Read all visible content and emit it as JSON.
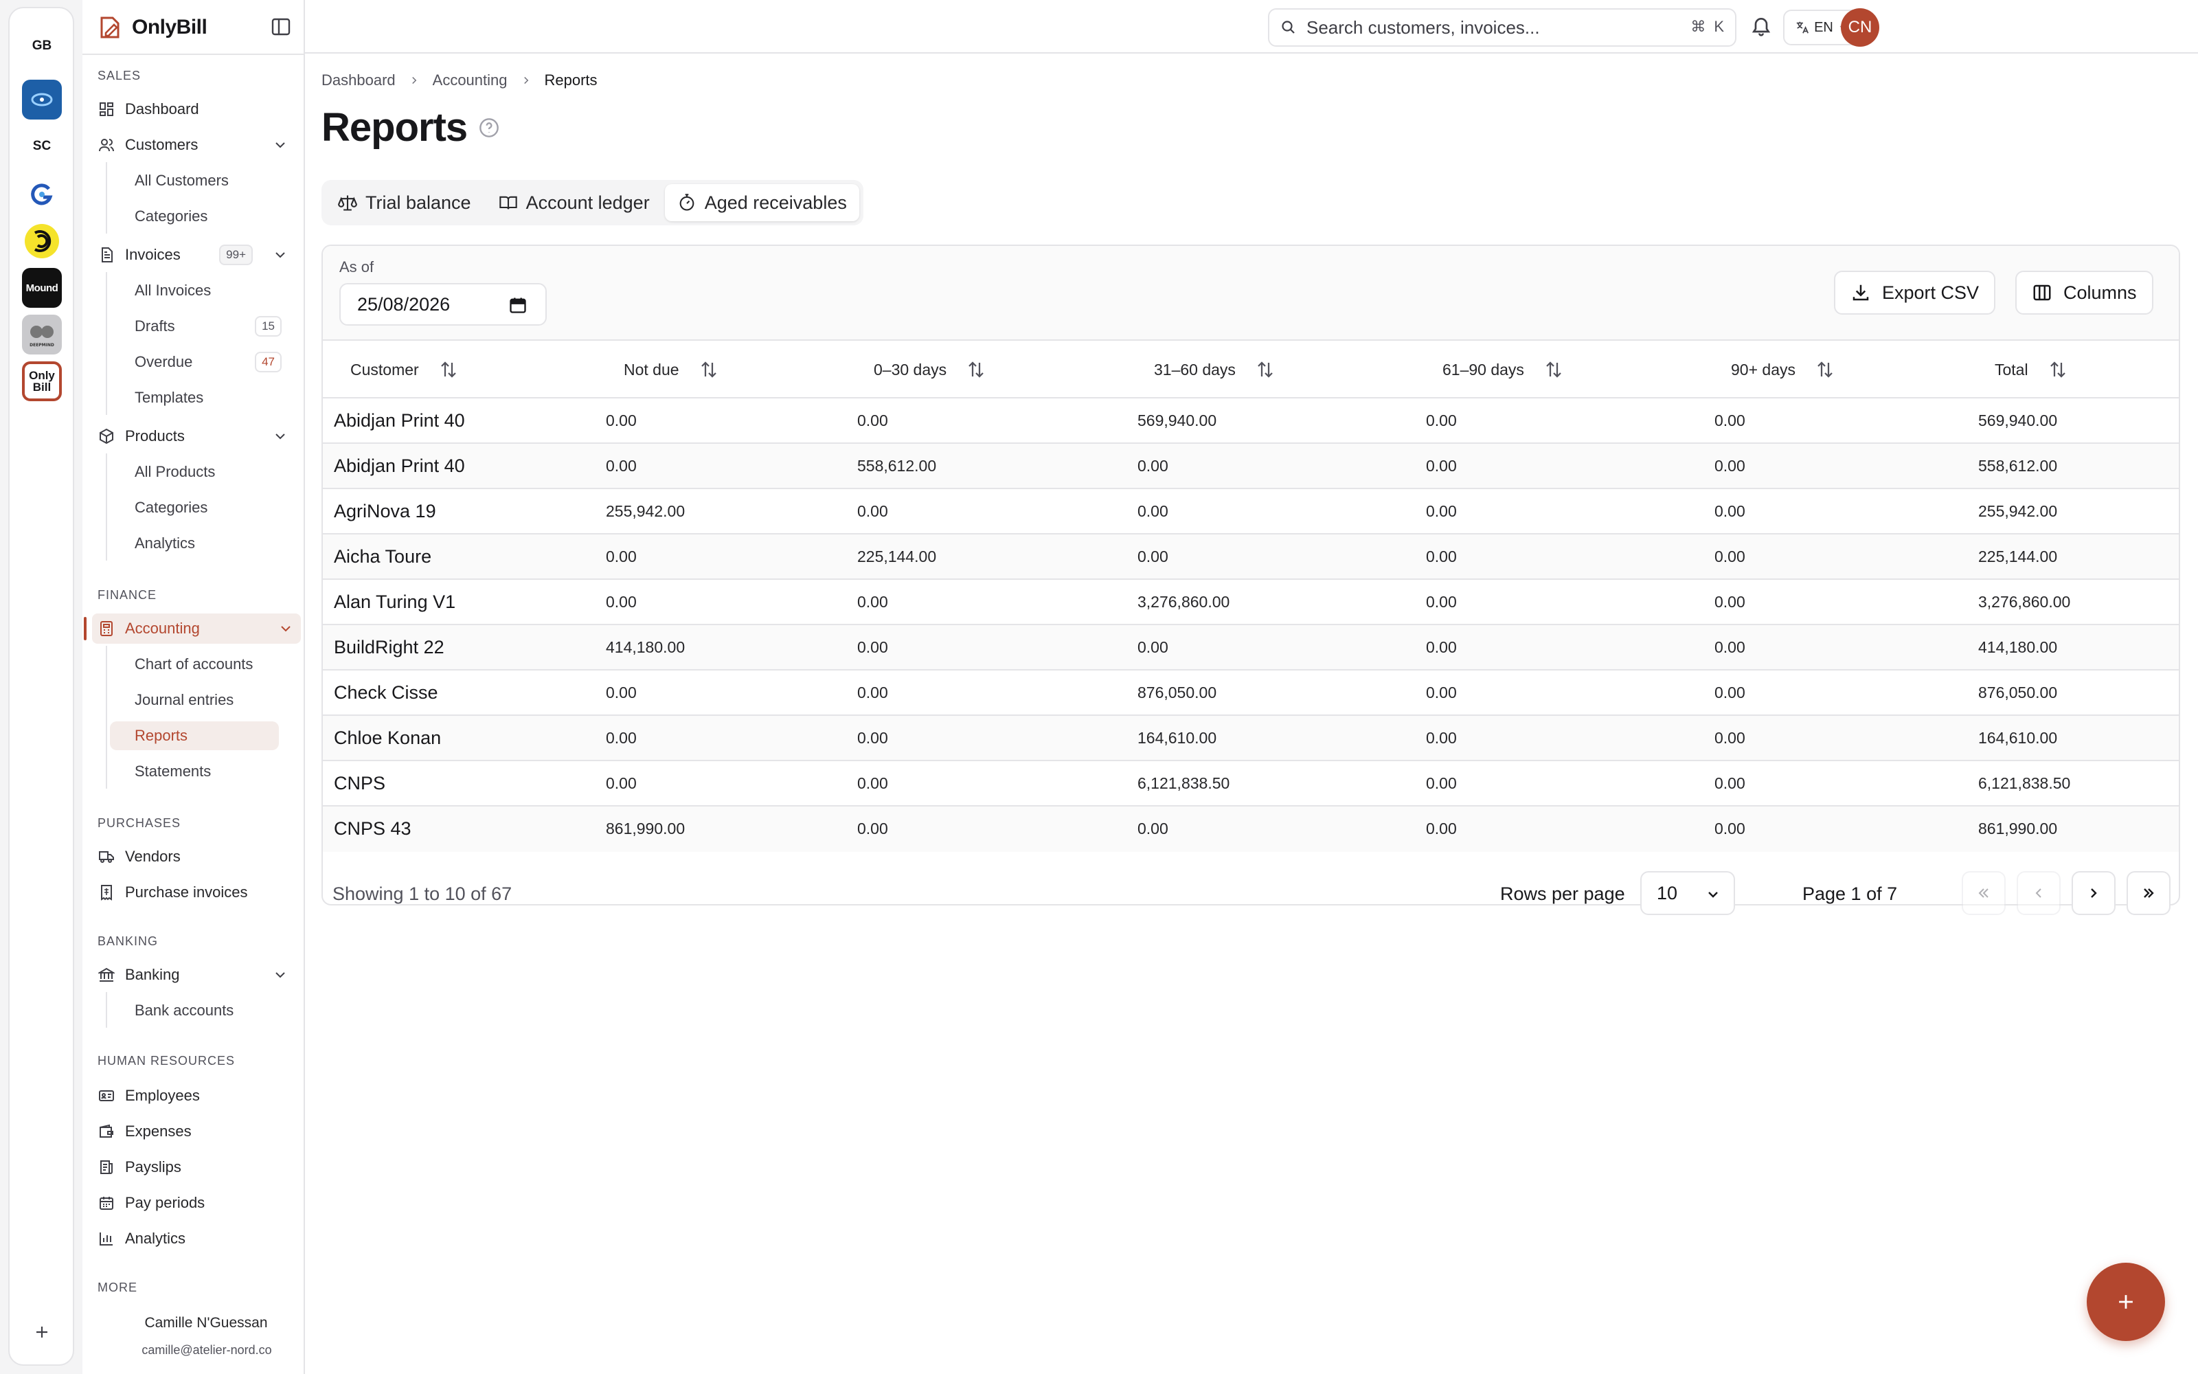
{
  "workspaces": {
    "items": [
      {
        "label": "GB",
        "kind": "text"
      },
      {
        "label": "",
        "kind": "blue"
      },
      {
        "label": "SC",
        "kind": "text"
      },
      {
        "label": "",
        "kind": "g"
      },
      {
        "label": "",
        "kind": "yellow"
      },
      {
        "label": "Mound",
        "kind": "mound"
      },
      {
        "label": "DEEPMIND",
        "kind": "deep"
      },
      {
        "label": "Only",
        "label2": "Bill",
        "kind": "ob"
      }
    ]
  },
  "brand": {
    "name": "OnlyBill"
  },
  "sidebar": {
    "sales_label": "SALES",
    "dashboard": "Dashboard",
    "customers": "Customers",
    "all_customers": "All Customers",
    "customer_categories": "Categories",
    "invoices": "Invoices",
    "invoices_badge": "99+",
    "all_invoices": "All Invoices",
    "drafts": "Drafts",
    "drafts_badge": "15",
    "overdue": "Overdue",
    "overdue_badge": "47",
    "templates": "Templates",
    "products": "Products",
    "all_products": "All Products",
    "product_categories": "Categories",
    "product_analytics": "Analytics",
    "finance_label": "FINANCE",
    "accounting": "Accounting",
    "chart_of_accounts": "Chart of accounts",
    "journal_entries": "Journal entries",
    "reports": "Reports",
    "statements": "Statements",
    "purchases_label": "PURCHASES",
    "vendors": "Vendors",
    "purchase_invoices": "Purchase invoices",
    "banking_label": "BANKING",
    "banking": "Banking",
    "bank_accounts": "Bank accounts",
    "hr_label": "HUMAN RESOURCES",
    "employees": "Employees",
    "expenses": "Expenses",
    "payslips": "Payslips",
    "pay_periods": "Pay periods",
    "hr_analytics": "Analytics",
    "more_label": "MORE"
  },
  "user": {
    "name": "Camille N'Guessan",
    "email": "camille@atelier-nord.co",
    "initials": "CN"
  },
  "topbar": {
    "search_placeholder": "Search customers, invoices...",
    "kbd_cmd": "⌘",
    "kbd_key": "K",
    "lang": "EN"
  },
  "breadcrumb": {
    "items": [
      "Dashboard",
      "Accounting",
      "Reports"
    ]
  },
  "page": {
    "title": "Reports"
  },
  "tabs": [
    {
      "label": "Trial balance",
      "active": false
    },
    {
      "label": "Account ledger",
      "active": false
    },
    {
      "label": "Aged receivables",
      "active": true
    }
  ],
  "filter": {
    "as_of_label": "As of",
    "as_of_value": "25/08/2026",
    "export_label": "Export CSV",
    "columns_label": "Columns"
  },
  "table": {
    "columns": [
      "Customer",
      "Not due",
      "0–30 days",
      "31–60 days",
      "61–90 days",
      "90+ days",
      "Total"
    ],
    "rows": [
      [
        "Abidjan Print 40",
        "0.00",
        "0.00",
        "569,940.00",
        "0.00",
        "0.00",
        "569,940.00"
      ],
      [
        "Abidjan Print 40",
        "0.00",
        "558,612.00",
        "0.00",
        "0.00",
        "0.00",
        "558,612.00"
      ],
      [
        "AgriNova 19",
        "255,942.00",
        "0.00",
        "0.00",
        "0.00",
        "0.00",
        "255,942.00"
      ],
      [
        "Aicha Toure",
        "0.00",
        "225,144.00",
        "0.00",
        "0.00",
        "0.00",
        "225,144.00"
      ],
      [
        "Alan Turing V1",
        "0.00",
        "0.00",
        "3,276,860.00",
        "0.00",
        "0.00",
        "3,276,860.00"
      ],
      [
        "BuildRight 22",
        "414,180.00",
        "0.00",
        "0.00",
        "0.00",
        "0.00",
        "414,180.00"
      ],
      [
        "Check Cisse",
        "0.00",
        "0.00",
        "876,050.00",
        "0.00",
        "0.00",
        "876,050.00"
      ],
      [
        "Chloe Konan",
        "0.00",
        "0.00",
        "164,610.00",
        "0.00",
        "0.00",
        "164,610.00"
      ],
      [
        "CNPS",
        "0.00",
        "0.00",
        "6,121,838.50",
        "0.00",
        "0.00",
        "6,121,838.50"
      ],
      [
        "CNPS 43",
        "861,990.00",
        "0.00",
        "0.00",
        "0.00",
        "0.00",
        "861,990.00"
      ]
    ]
  },
  "pagination": {
    "showing": "Showing 1 to 10 of 67",
    "rows_per_page_label": "Rows per page",
    "rows_per_page_value": "10",
    "page_label": "Page 1 of 7"
  },
  "colors": {
    "accent": "#b3472f",
    "border": "#e4e4e7",
    "active_bg": "#f4ece9"
  }
}
